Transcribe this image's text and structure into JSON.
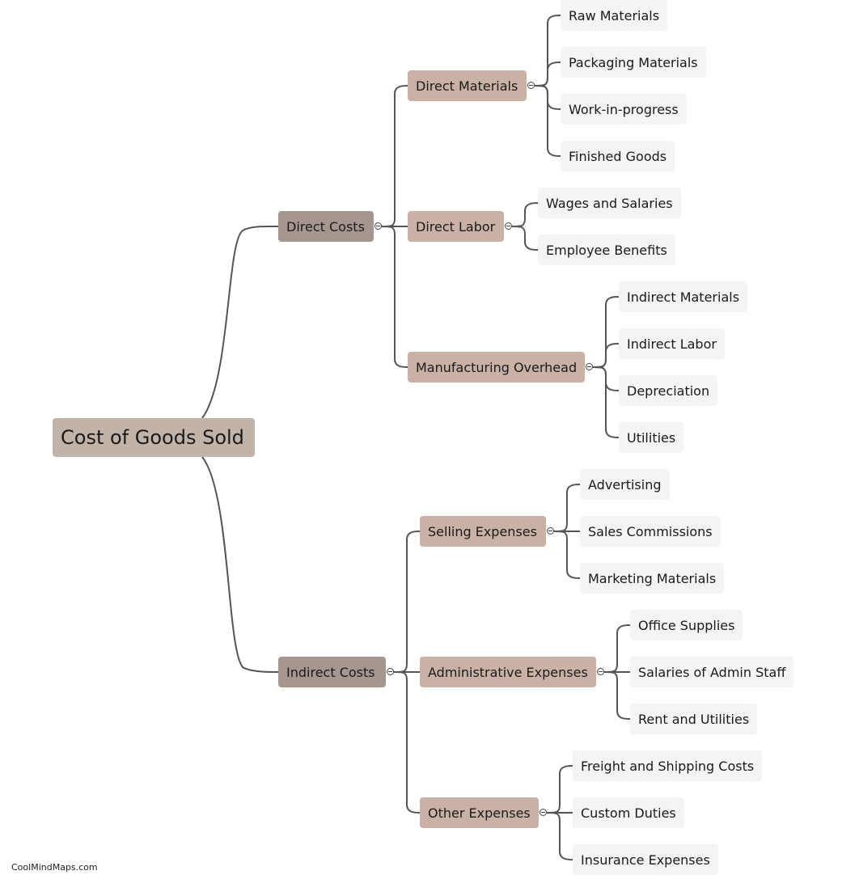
{
  "watermark": "CoolMindMaps.com",
  "mindmap": {
    "root": "Cost of Goods Sold",
    "branches": [
      {
        "label": "Direct Costs",
        "children": [
          {
            "label": "Direct Materials",
            "children": [
              "Raw Materials",
              "Packaging Materials",
              "Work-in-progress",
              "Finished Goods"
            ]
          },
          {
            "label": "Direct Labor",
            "children": [
              "Wages and Salaries",
              "Employee Benefits"
            ]
          },
          {
            "label": "Manufacturing Overhead",
            "children": [
              "Indirect Materials",
              "Indirect Labor",
              "Depreciation",
              "Utilities"
            ]
          }
        ]
      },
      {
        "label": "Indirect Costs",
        "children": [
          {
            "label": "Selling Expenses",
            "children": [
              "Advertising",
              "Sales Commissions",
              "Marketing Materials"
            ]
          },
          {
            "label": "Administrative Expenses",
            "children": [
              "Office Supplies",
              "Salaries of Admin Staff",
              "Rent and Utilities"
            ]
          },
          {
            "label": "Other Expenses",
            "children": [
              "Freight and Shipping Costs",
              "Custom Duties",
              "Insurance Expenses"
            ]
          }
        ]
      }
    ]
  },
  "colors": {
    "root": "#c2b3a8",
    "level1": "#a59690",
    "level2": "#c9b1a6",
    "leaf": "#f4f4f4",
    "connector": "#555555"
  }
}
